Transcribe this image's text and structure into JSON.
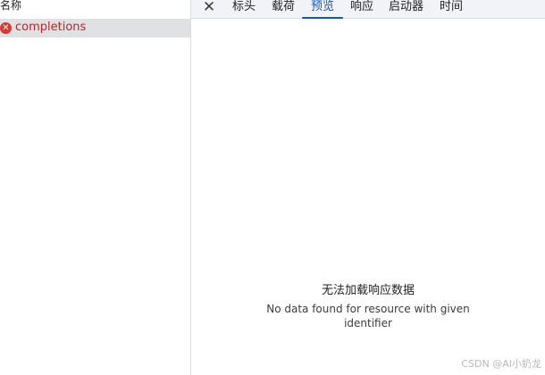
{
  "request_list": {
    "column_header": "名称",
    "rows": [
      {
        "name": "completions",
        "status": "error"
      }
    ]
  },
  "detail_tabs": {
    "close_glyph": "✕",
    "tabs": [
      {
        "label": "标头",
        "active": false
      },
      {
        "label": "载荷",
        "active": false
      },
      {
        "label": "预览",
        "active": true
      },
      {
        "label": "响应",
        "active": false
      },
      {
        "label": "启动器",
        "active": false
      },
      {
        "label": "时间",
        "active": false
      }
    ]
  },
  "preview": {
    "title": "无法加载响应数据",
    "message": "No data found for resource with given identifier"
  },
  "watermark": "CSDN @AI小奶龙",
  "colors": {
    "accent": "#0b57d0",
    "error": "#dc362e",
    "error_text": "#c5221f",
    "selected_row": "#dfe1e5",
    "tab_bar": "#f1f3f9"
  },
  "icons": {
    "error": "error-x-circle-icon",
    "close": "close-icon"
  }
}
